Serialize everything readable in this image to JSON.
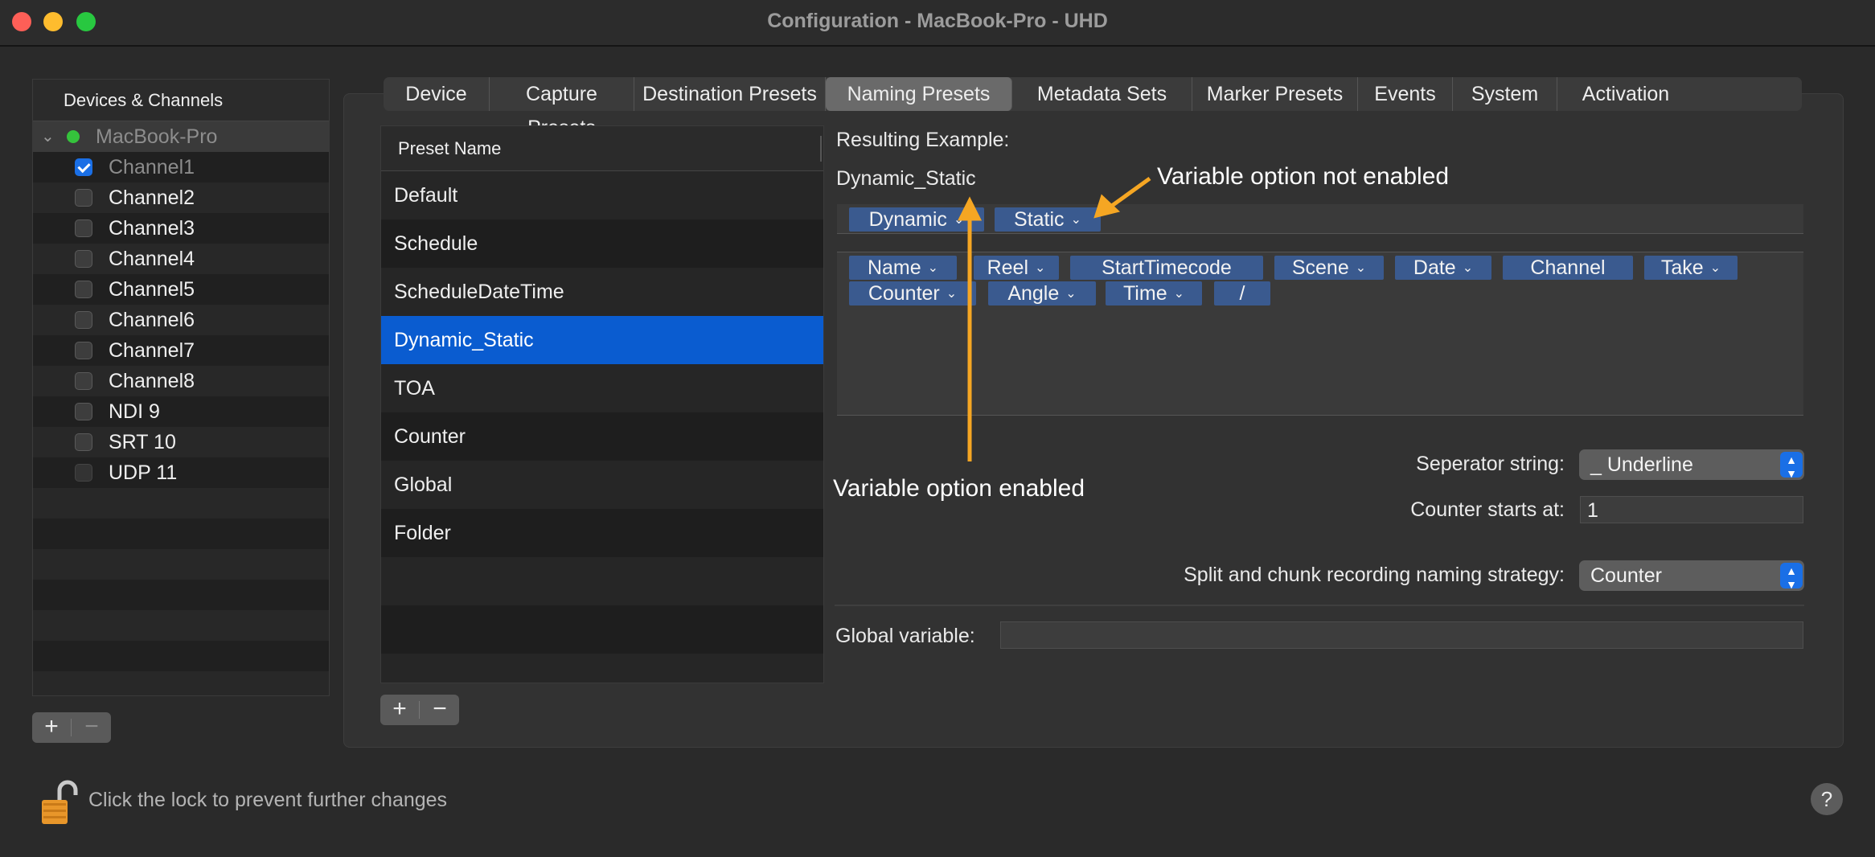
{
  "window": {
    "title": "Configuration - MacBook-Pro - UHD"
  },
  "sidebar": {
    "header": "Devices & Channels",
    "device": "MacBook-Pro",
    "channels": [
      {
        "label": "Channel1",
        "checked": true
      },
      {
        "label": "Channel2",
        "checked": false
      },
      {
        "label": "Channel3",
        "checked": false
      },
      {
        "label": "Channel4",
        "checked": false
      },
      {
        "label": "Channel5",
        "checked": false
      },
      {
        "label": "Channel6",
        "checked": false
      },
      {
        "label": "Channel7",
        "checked": false
      },
      {
        "label": "Channel8",
        "checked": false
      },
      {
        "label": "NDI 9",
        "checked": false
      },
      {
        "label": "SRT 10",
        "checked": false
      },
      {
        "label": "UDP 11",
        "checked": false
      }
    ],
    "add_label": "+",
    "remove_label": "−"
  },
  "tabs": [
    {
      "label": "Device"
    },
    {
      "label": "Capture Presets"
    },
    {
      "label": "Destination Presets"
    },
    {
      "label": "Naming Presets",
      "active": true
    },
    {
      "label": "Metadata Sets"
    },
    {
      "label": "Marker Presets"
    },
    {
      "label": "Events"
    },
    {
      "label": "System"
    },
    {
      "label": "Activation"
    }
  ],
  "presets": {
    "header": "Preset Name",
    "items": [
      "Default",
      "Schedule",
      "ScheduleDateTime",
      "Dynamic_Static",
      "TOA",
      "Counter",
      "Global",
      "Folder"
    ],
    "selected": "Dynamic_Static",
    "add_label": "+",
    "remove_label": "−"
  },
  "naming": {
    "resulting_label": "Resulting Example:",
    "resulting_value": "Dynamic_Static",
    "active_tokens": [
      {
        "label": "Dynamic",
        "has_menu": true
      },
      {
        "label": "Static",
        "has_menu": true
      }
    ],
    "available_tokens": [
      {
        "label": "Name",
        "has_menu": true
      },
      {
        "label": "Reel",
        "has_menu": true
      },
      {
        "label": "StartTimecode",
        "has_menu": false
      },
      {
        "label": "Scene",
        "has_menu": true
      },
      {
        "label": "Date",
        "has_menu": true
      },
      {
        "label": "Channel",
        "has_menu": false
      },
      {
        "label": "Take",
        "has_menu": true
      },
      {
        "label": "Counter",
        "has_menu": true
      },
      {
        "label": "Angle",
        "has_menu": true
      },
      {
        "label": "Time",
        "has_menu": true
      },
      {
        "label": "/",
        "has_menu": false
      }
    ],
    "separator_label": "Seperator string:",
    "separator_value": "_ Underline",
    "counter_label": "Counter starts at:",
    "counter_value": "1",
    "split_label": "Split and chunk recording naming strategy:",
    "split_value": "Counter",
    "global_label": "Global variable:",
    "global_value": ""
  },
  "annotations": {
    "not_enabled": "Variable option not enabled",
    "enabled": "Variable option enabled",
    "color": "#f5a623"
  },
  "footer": {
    "lock_text": "Click the lock to prevent further changes",
    "help_label": "?"
  },
  "colors": {
    "accent": "#1a6fe6",
    "selection": "#0a5cd0",
    "token": "#3a5a8f"
  }
}
